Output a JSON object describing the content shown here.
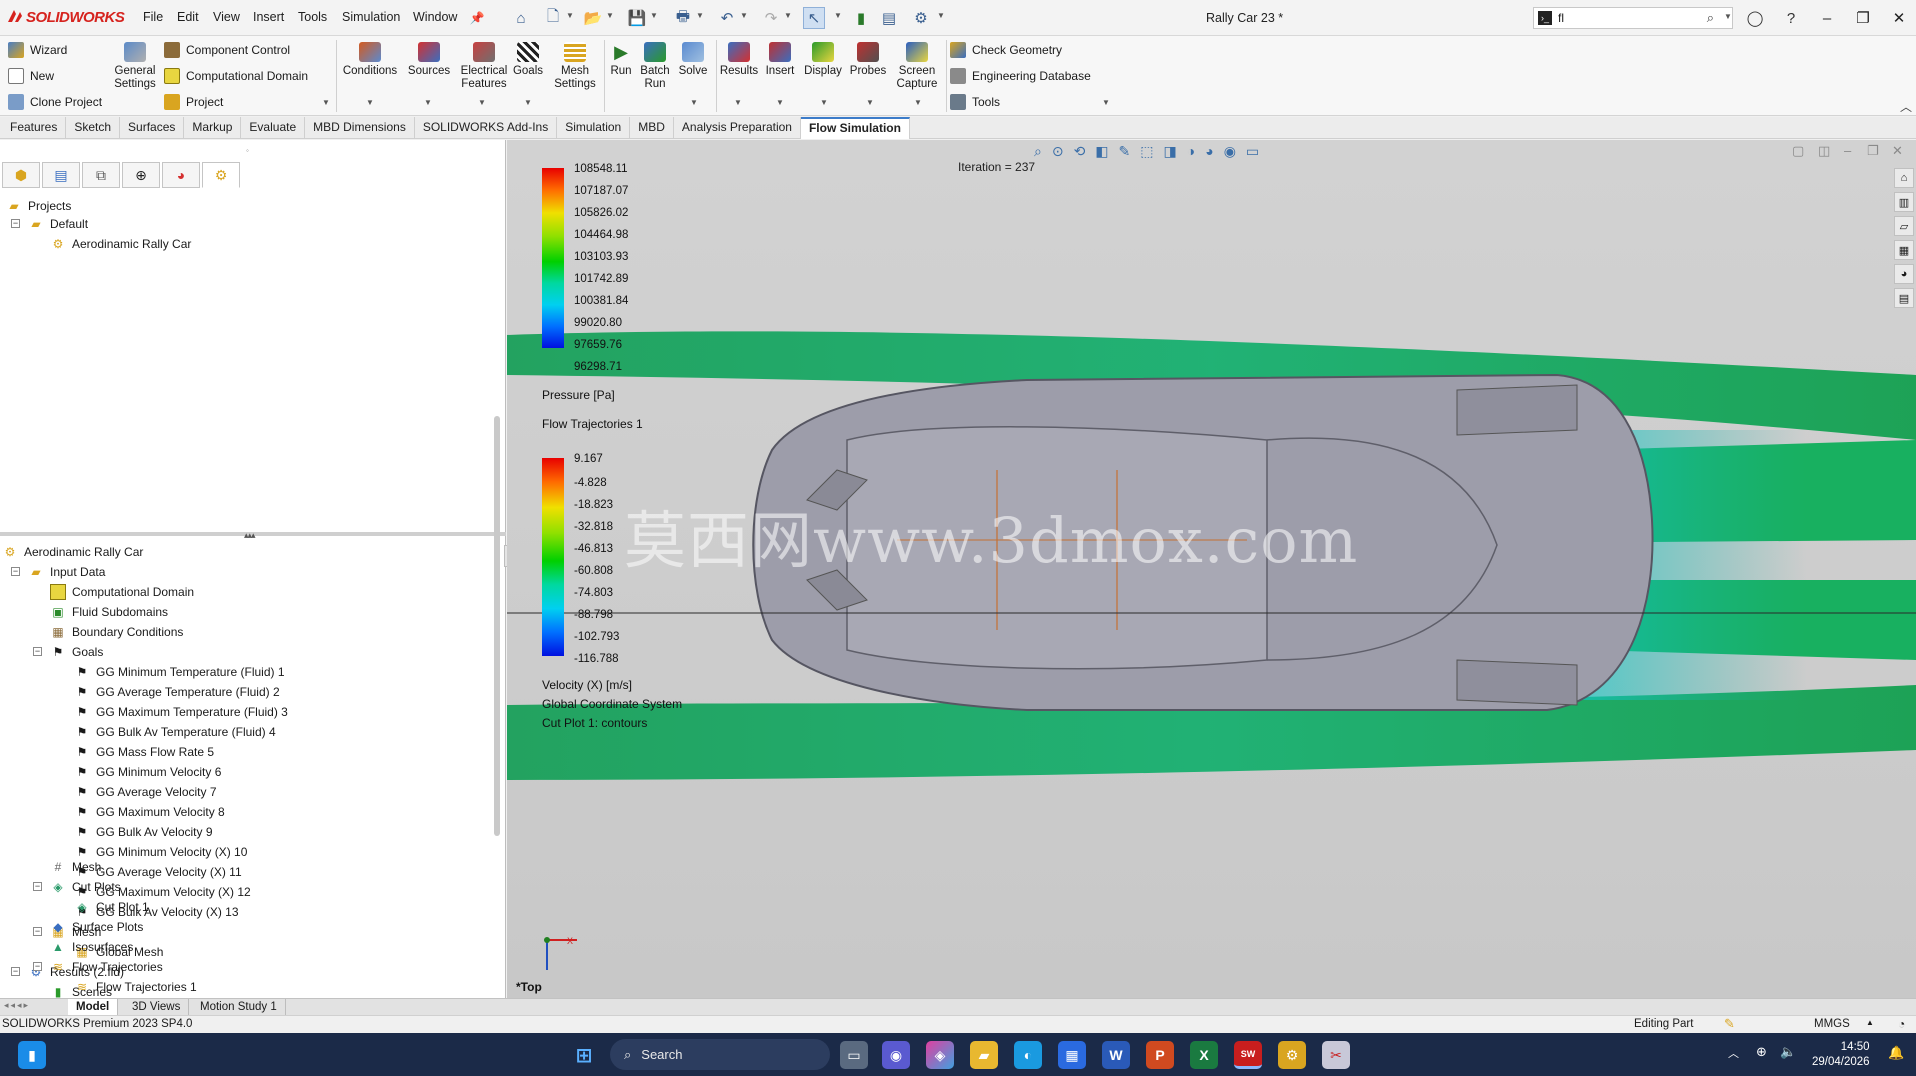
{
  "app": {
    "brand": "SOLIDWORKS",
    "doc_title": "Rally Car 23 *"
  },
  "menu": [
    "File",
    "Edit",
    "View",
    "Insert",
    "Tools",
    "Simulation",
    "Window"
  ],
  "search": {
    "value": "fl"
  },
  "ribbon": {
    "left_items": [
      "Wizard",
      "New",
      "Clone Project"
    ],
    "general_settings": "General Settings",
    "mid_items": [
      "Component Control",
      "Computational Domain",
      "Project"
    ],
    "big_buttons": [
      "Conditions",
      "Sources",
      "Electrical Features",
      "Goals",
      "Mesh Settings",
      "Run",
      "Batch Run",
      "Solve",
      "Results",
      "Insert",
      "Display",
      "Probes",
      "Screen Capture"
    ],
    "right_items": [
      "Check Geometry",
      "Engineering Database",
      "Tools"
    ]
  },
  "tabs": [
    "Features",
    "Sketch",
    "Surfaces",
    "Markup",
    "Evaluate",
    "MBD Dimensions",
    "SOLIDWORKS Add-Ins",
    "Simulation",
    "MBD",
    "Analysis Preparation",
    "Flow Simulation"
  ],
  "active_tab": "Flow Simulation",
  "projects_tree": {
    "root": "Projects",
    "default": "Default",
    "project": "Aerodinamic Rally Car"
  },
  "analysis_tree": {
    "root": "Aerodinamic Rally Car",
    "input_data": "Input Data",
    "computational_domain": "Computational Domain",
    "fluid_subdomains": "Fluid Subdomains",
    "boundary_conditions": "Boundary Conditions",
    "goals_label": "Goals",
    "goals": [
      "GG Minimum Temperature (Fluid) 1",
      "GG Average Temperature (Fluid) 2",
      "GG Maximum Temperature (Fluid) 3",
      "GG Bulk Av Temperature (Fluid) 4",
      "GG Mass Flow Rate 5",
      "GG Minimum Velocity 6",
      "GG Average Velocity 7",
      "GG Maximum Velocity 8",
      "GG Bulk Av Velocity 9",
      "GG Minimum Velocity (X) 10",
      "GG Average Velocity (X) 11",
      "GG Maximum Velocity (X) 12",
      "GG Bulk Av Velocity (X) 13"
    ],
    "mesh": "Mesh",
    "global_mesh": "Global Mesh",
    "results": "Results (2.fld)",
    "scenes": "Scenes",
    "results_mesh": "Mesh",
    "cut_plots": "Cut Plots",
    "cut_plot_1": "Cut Plot 1",
    "surface_plots": "Surface Plots",
    "isosurfaces": "Isosurfaces",
    "flow_trajectories": "Flow Trajectories",
    "flow_trajectories_1": "Flow Trajectories 1"
  },
  "viewport": {
    "iteration": "Iteration = 237",
    "pressure_legend": {
      "values": [
        "108548.11",
        "107187.07",
        "105826.02",
        "104464.98",
        "103103.93",
        "101742.89",
        "100381.84",
        "99020.80",
        "97659.76",
        "96298.71"
      ],
      "title": "Pressure [Pa]"
    },
    "flow_label": "Flow Trajectories 1",
    "velocity_legend": {
      "values": [
        "9.167",
        "-4.828",
        "-18.823",
        "-32.818",
        "-46.813",
        "-60.808",
        "-74.803",
        "-88.798",
        "-102.793",
        "-116.788"
      ],
      "title": "Velocity (X) [m/s]"
    },
    "coordinate_system": "Global Coordinate System",
    "cut_plot_caption": "Cut Plot 1: contours",
    "view_name": "*Top",
    "watermark": "莫西网www.3dmox.com"
  },
  "bottom_tabs": [
    "Model",
    "3D Views",
    "Motion Study 1"
  ],
  "status": {
    "version": "SOLIDWORKS Premium 2023 SP4.0",
    "mode": "Editing Part",
    "units": "MMGS"
  },
  "taskbar": {
    "search": "Search",
    "time": "14:50",
    "date": "29/04/2026"
  },
  "colors": {
    "accent": "#3c7cc9",
    "brand": "#d6231e",
    "taskbar": "#1b2a48"
  }
}
